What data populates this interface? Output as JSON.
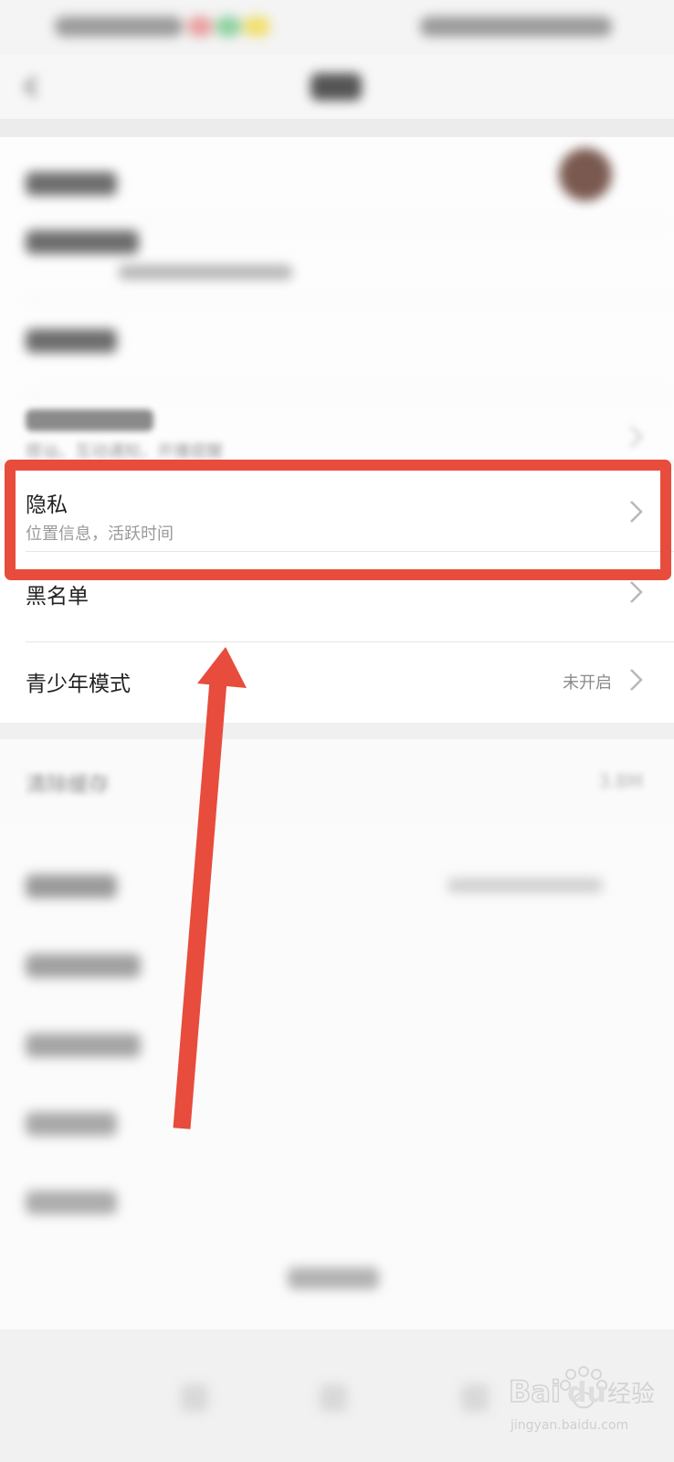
{
  "settings": {
    "privacy": {
      "title": "隐私",
      "subtitle": "位置信息，活跃时间"
    },
    "blacklist": {
      "title": "黑名单"
    },
    "teen_mode": {
      "title": "青少年模式",
      "value": "未开启"
    },
    "clear_cache": {
      "title": "清除缓存",
      "value": "3.8M"
    }
  },
  "blurred_fragments": {
    "notifications_subtitle": "搭讪，互动通知，开播提醒"
  },
  "annotation": {
    "highlight_color": "#e74c3c",
    "arrow_color": "#e74c3c"
  },
  "watermark": {
    "brand": "Baidu经验",
    "url": "jingyan.baidu.com"
  },
  "icons": {
    "back": "back-arrow-icon",
    "chevron": "chevron-right-icon",
    "avatar": "avatar"
  }
}
